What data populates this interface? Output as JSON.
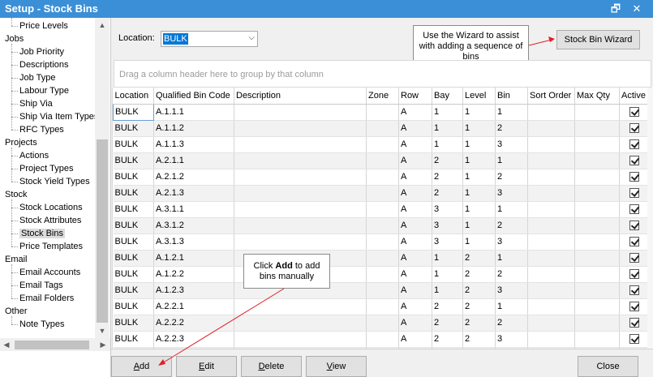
{
  "window": {
    "title": "Setup - Stock Bins",
    "restore_icon": "restore-icon",
    "close_icon": "close-icon"
  },
  "tree": {
    "items": [
      {
        "label": "Price Levels",
        "level": 1
      },
      {
        "label": "Jobs",
        "level": 0
      },
      {
        "label": "Job Priority",
        "level": 1
      },
      {
        "label": "Descriptions",
        "level": 1
      },
      {
        "label": "Job Type",
        "level": 1
      },
      {
        "label": "Labour Type",
        "level": 1
      },
      {
        "label": "Ship Via",
        "level": 1
      },
      {
        "label": "Ship Via Item Types",
        "level": 1
      },
      {
        "label": "RFC Types",
        "level": 1
      },
      {
        "label": "Projects",
        "level": 0
      },
      {
        "label": "Actions",
        "level": 1
      },
      {
        "label": "Project Types",
        "level": 1
      },
      {
        "label": "Stock Yield Types",
        "level": 1
      },
      {
        "label": "Stock",
        "level": 0
      },
      {
        "label": "Stock Locations",
        "level": 1
      },
      {
        "label": "Stock Attributes",
        "level": 1
      },
      {
        "label": "Stock Bins",
        "level": 1,
        "selected": true
      },
      {
        "label": "Price Templates",
        "level": 1
      },
      {
        "label": "Email",
        "level": 0
      },
      {
        "label": "Email Accounts",
        "level": 1
      },
      {
        "label": "Email Tags",
        "level": 1
      },
      {
        "label": "Email Folders",
        "level": 1
      },
      {
        "label": "Other",
        "level": 0
      },
      {
        "label": "Note Types",
        "level": 1
      }
    ]
  },
  "location": {
    "label": "Location:",
    "value": "BULK"
  },
  "callouts": {
    "wizard": "Use the Wizard to assist with adding a sequence of bins",
    "add_prefix": "Click ",
    "add_bold": "Add",
    "add_suffix": " to add bins manually"
  },
  "wizard_button": "Stock Bin Wizard",
  "group_hint": "Drag a column header here to group by that column",
  "grid": {
    "columns": [
      "Location",
      "Qualified Bin Code",
      "Description",
      "Zone",
      "Row",
      "Bay",
      "Level",
      "Bin",
      "Sort Order",
      "Max Qty",
      "Active"
    ],
    "rows": [
      [
        "BULK",
        "A.1.1.1",
        "",
        "",
        "A",
        "1",
        "1",
        "1",
        "",
        "",
        true
      ],
      [
        "BULK",
        "A.1.1.2",
        "",
        "",
        "A",
        "1",
        "1",
        "2",
        "",
        "",
        true
      ],
      [
        "BULK",
        "A.1.1.3",
        "",
        "",
        "A",
        "1",
        "1",
        "3",
        "",
        "",
        true
      ],
      [
        "BULK",
        "A.2.1.1",
        "",
        "",
        "A",
        "2",
        "1",
        "1",
        "",
        "",
        true
      ],
      [
        "BULK",
        "A.2.1.2",
        "",
        "",
        "A",
        "2",
        "1",
        "2",
        "",
        "",
        true
      ],
      [
        "BULK",
        "A.2.1.3",
        "",
        "",
        "A",
        "2",
        "1",
        "3",
        "",
        "",
        true
      ],
      [
        "BULK",
        "A.3.1.1",
        "",
        "",
        "A",
        "3",
        "1",
        "1",
        "",
        "",
        true
      ],
      [
        "BULK",
        "A.3.1.2",
        "",
        "",
        "A",
        "3",
        "1",
        "2",
        "",
        "",
        true
      ],
      [
        "BULK",
        "A.3.1.3",
        "",
        "",
        "A",
        "3",
        "1",
        "3",
        "",
        "",
        true
      ],
      [
        "BULK",
        "A.1.2.1",
        "",
        "",
        "A",
        "1",
        "2",
        "1",
        "",
        "",
        true
      ],
      [
        "BULK",
        "A.1.2.2",
        "",
        "",
        "A",
        "1",
        "2",
        "2",
        "",
        "",
        true
      ],
      [
        "BULK",
        "A.1.2.3",
        "",
        "",
        "A",
        "1",
        "2",
        "3",
        "",
        "",
        true
      ],
      [
        "BULK",
        "A.2.2.1",
        "",
        "",
        "A",
        "2",
        "2",
        "1",
        "",
        "",
        true
      ],
      [
        "BULK",
        "A.2.2.2",
        "",
        "",
        "A",
        "2",
        "2",
        "2",
        "",
        "",
        true
      ],
      [
        "BULK",
        "A.2.2.3",
        "",
        "",
        "A",
        "2",
        "2",
        "3",
        "",
        "",
        true
      ],
      [
        "",
        "",
        "",
        "",
        "",
        "",
        "",
        "",
        "",
        "",
        true
      ]
    ]
  },
  "buttons": {
    "add": {
      "mnemonic": "A",
      "rest": "dd"
    },
    "edit": {
      "mnemonic": "E",
      "rest": "dit"
    },
    "delete": {
      "mnemonic": "D",
      "rest": "elete"
    },
    "view": {
      "mnemonic": "V",
      "rest": "iew"
    },
    "close": "Close"
  },
  "colors": {
    "titlebar": "#3b8fd6",
    "annotation_arrow": "#e0202a",
    "selection": "#0078d7"
  }
}
